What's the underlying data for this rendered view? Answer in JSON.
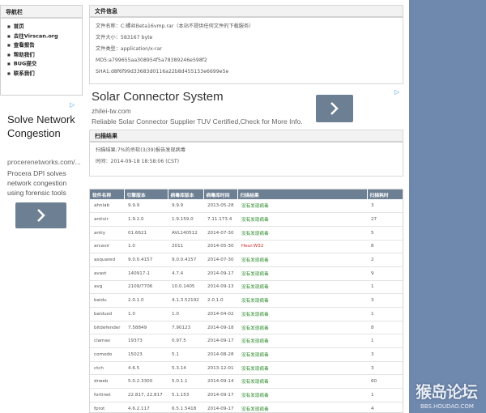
{
  "nav": {
    "title": "导航栏",
    "items": [
      "首页",
      "去往Virscan.org",
      "查看报告",
      "帮助我们",
      "BUG提交",
      "联系我们"
    ]
  },
  "left_ad": {
    "adchoice": "▷",
    "title": "Solve Network Congestion",
    "url": "procerenetworks.com/...",
    "desc": "Procera DPI solves network congestion using forensic tools"
  },
  "file_info": {
    "title": "文件信息",
    "lines": [
      "文件名称：C:螺丝Beta16vmp.rar（本站不提供任何文件的下载服务）",
      "文件大小：583167 byte",
      "文件类型：application/x-rar",
      "MD5:a799655aa308954f5a78389246e598f2",
      "SHA1:d8f6f99d33683d0116a22b8d455153e6699e5e"
    ]
  },
  "mid_ad": {
    "adchoice": "▷",
    "title": "Solar Connector System",
    "url": "zhilei-tw.com",
    "desc": "Reliable Solar Connector Supplier TUV Certified,Check for More Info."
  },
  "scan_result": {
    "title": "扫描结果",
    "summary": "扫描结果:7%的杀软(3/39)报告发现病毒",
    "time": "时间：2014-09-18 18:58:06 (CST)"
  },
  "table": {
    "headers": [
      "软件名称",
      "引擎版本",
      "病毒库版本",
      "病毒库时间",
      "扫描结果",
      "扫描耗时"
    ],
    "rows": [
      [
        "ahnlab",
        "9.9.9",
        "9.9.9",
        "2013-05-28",
        "没有发现病毒",
        "3"
      ],
      [
        "antivir",
        "1.9.2.0",
        "1.9.159.0",
        "7.11.173.4",
        "没有发现病毒",
        "27"
      ],
      [
        "antiy",
        "01.6621",
        "AVL140512",
        "2014-07-30",
        "没有发现病毒",
        "5"
      ],
      [
        "arcavir",
        "1.0",
        "2011",
        "2014-05-30",
        "Heur.W32",
        "8"
      ],
      [
        "asquared",
        "9.0.0.4157",
        "9.0.0.4157",
        "2014-07-30",
        "没有发现病毒",
        "2"
      ],
      [
        "avast",
        "140917-1",
        "4.7.4",
        "2014-09-17",
        "没有发现病毒",
        "9"
      ],
      [
        "avg",
        "2109/7706",
        "10.0.1405",
        "2014-09-13",
        "没有发现病毒",
        "1"
      ],
      [
        "baidu",
        "2.0.1.0",
        "4.1.3.52192",
        "2.0.1.0",
        "没有发现病毒",
        "3"
      ],
      [
        "baidusd",
        "1.0",
        "1.0",
        "2014-04-02",
        "没有发现病毒",
        "1"
      ],
      [
        "bitdefender",
        "7.58849",
        "7.90123",
        "2014-09-18",
        "没有发现病毒",
        "8"
      ],
      [
        "clamav",
        "19373",
        "0.97.5",
        "2014-09-17",
        "没有发现病毒",
        "1"
      ],
      [
        "comodo",
        "15023",
        "5.1",
        "2014-08-28",
        "没有发现病毒",
        "3"
      ],
      [
        "ctch",
        "4.6.5",
        "5.3.14",
        "2013-12-01",
        "没有发现病毒",
        "3"
      ],
      [
        "drweb",
        "5.0.2.3300",
        "5.0.1.1",
        "2014-09-14",
        "没有发现病毒",
        "60"
      ],
      [
        "fortinet",
        "22.817, 22.817",
        "5.1.153",
        "2014-09-17",
        "没有发现病毒",
        "1"
      ],
      [
        "fprot",
        "4.6.2.117",
        "6.5.1.5418",
        "2014-09-17",
        "没有发现病毒",
        "4"
      ]
    ]
  },
  "watermark": {
    "big": "猴岛论坛",
    "small": "BBS.HOUDAO.COM"
  }
}
